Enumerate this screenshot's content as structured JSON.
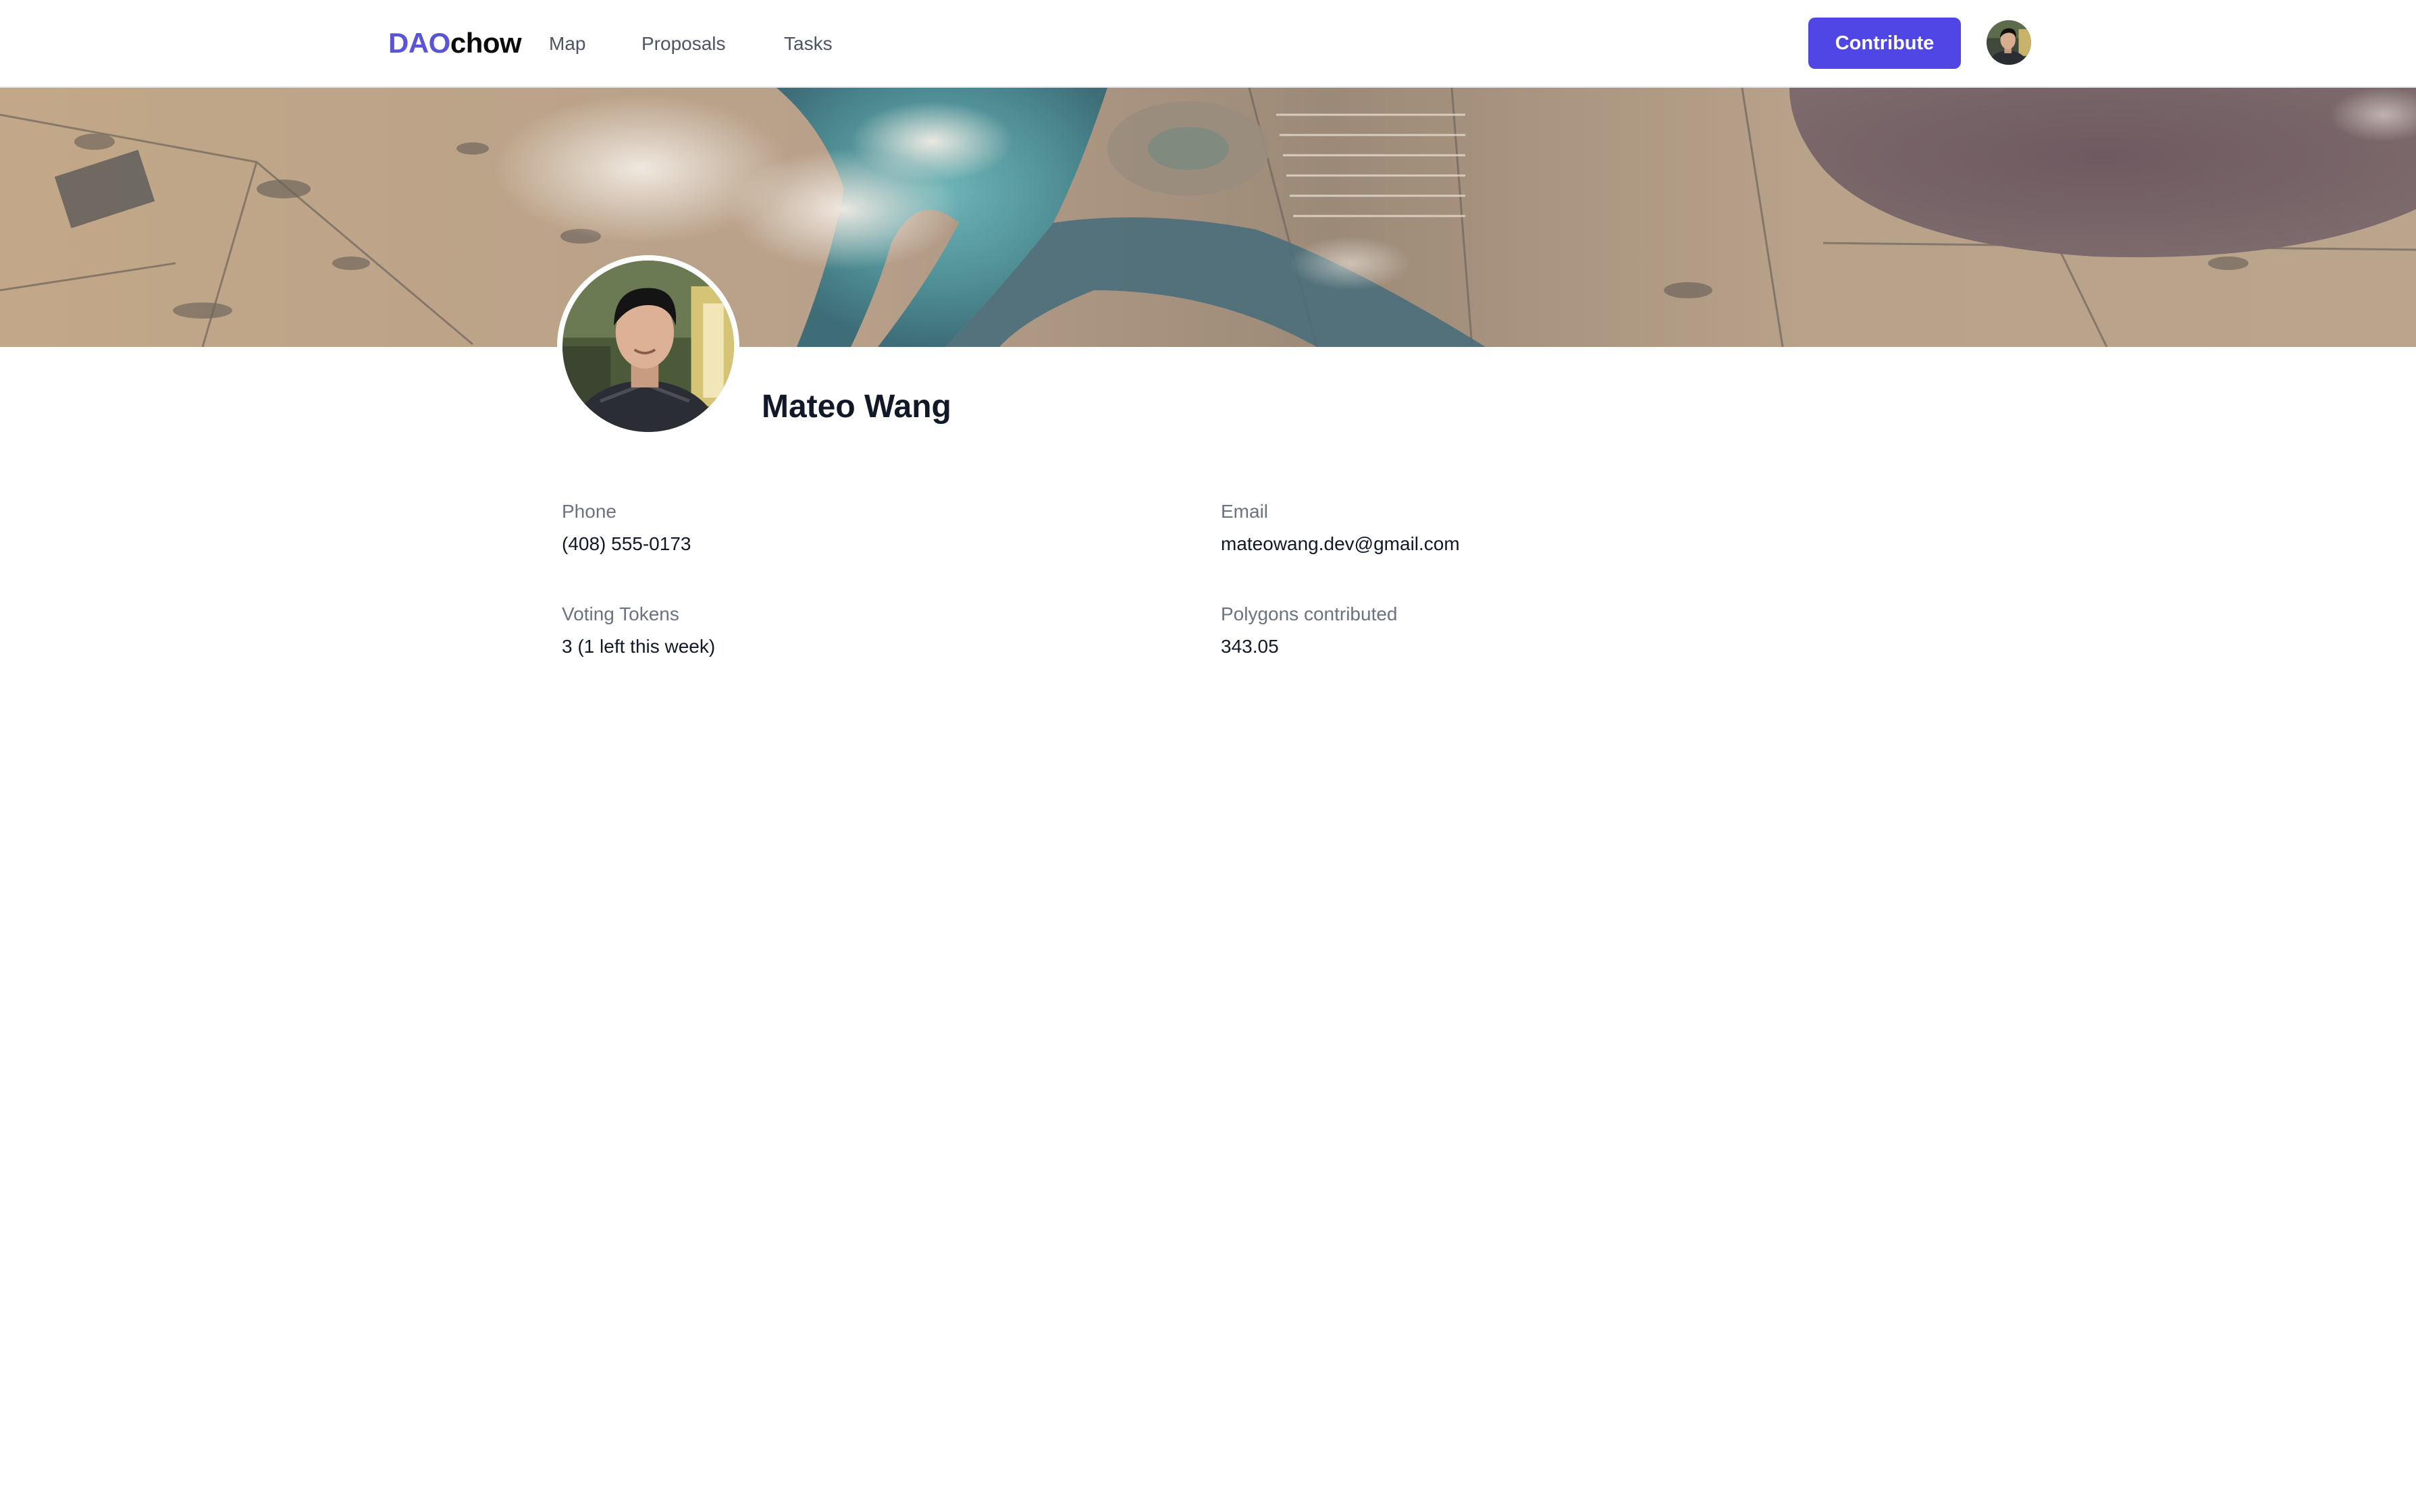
{
  "navbar": {
    "brand_primary": "DAO",
    "brand_secondary": "chow",
    "links": [
      {
        "label": "Map"
      },
      {
        "label": "Proposals"
      },
      {
        "label": "Tasks"
      }
    ],
    "contribute_label": "Contribute"
  },
  "colors": {
    "accent": "#4f46e5",
    "brand": "#5a55d6",
    "label_gray": "#6b7280",
    "text_dark": "#111827"
  },
  "icons": {
    "user_avatar": "user-avatar-photo",
    "banner": "aerial-landscape-photo"
  },
  "profile": {
    "name": "Mateo Wang",
    "fields": {
      "phone": {
        "label": "Phone",
        "value": "(408) 555-0173"
      },
      "email": {
        "label": "Email",
        "value": "mateowang.dev@gmail.com"
      },
      "tokens": {
        "label": "Voting Tokens",
        "value": "3 (1 left this week)"
      },
      "polygons": {
        "label": "Polygons contributed",
        "value": "343.05"
      }
    }
  }
}
